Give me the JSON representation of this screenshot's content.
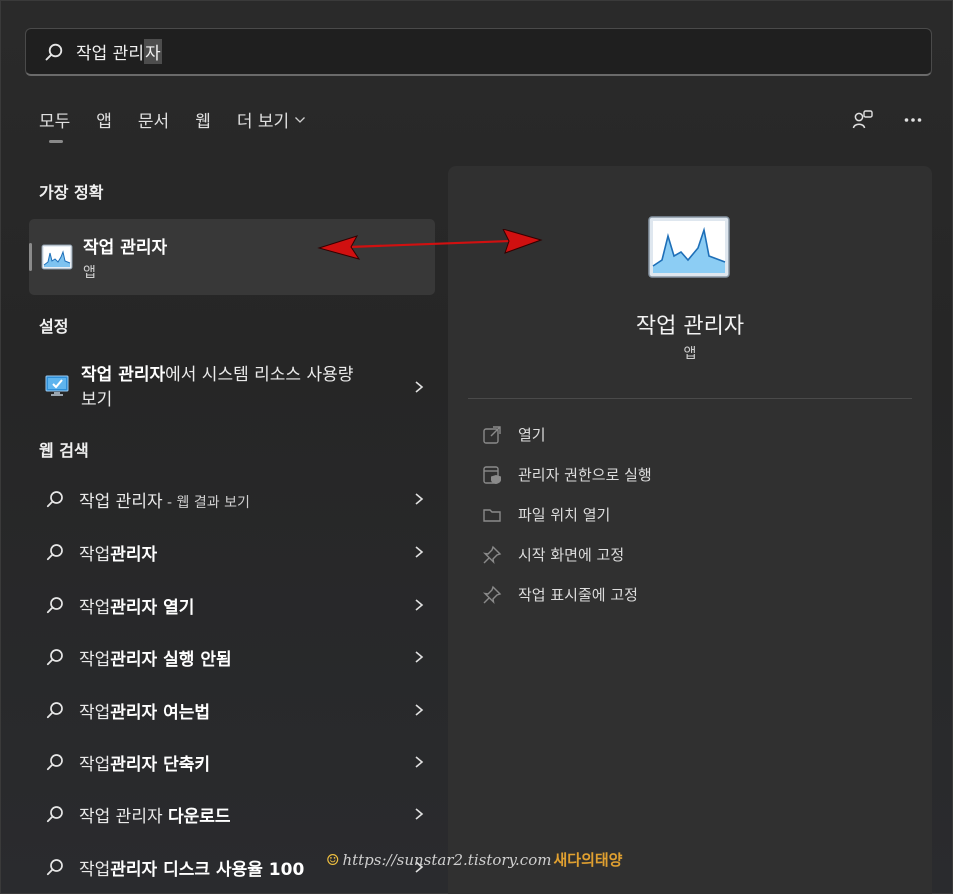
{
  "search": {
    "query_prefix": "작업 관리",
    "query_caret": "자"
  },
  "tabs": [
    {
      "label": "모두"
    },
    {
      "label": "앱"
    },
    {
      "label": "문서"
    },
    {
      "label": "웹"
    },
    {
      "label": "더 보기"
    }
  ],
  "sections": {
    "best_match": "가장 정확",
    "settings": "설정",
    "web_search": "웹 검색"
  },
  "best_match": {
    "title": "작업 관리자",
    "subtitle": "앱"
  },
  "setting_item": {
    "bold": "작업 관리자",
    "rest": "에서 시스템 리소스 사용량 보기"
  },
  "web_items": [
    {
      "bold": "",
      "plain": "작업 관리자",
      "small": " - 웹 결과 보기"
    },
    {
      "plain": "작업",
      "bold": "관리자"
    },
    {
      "plain": "작업",
      "bold": "관리자 열기"
    },
    {
      "plain": "작업",
      "bold": "관리자 실행 안됨"
    },
    {
      "plain": "작업",
      "bold": "관리자 여는법"
    },
    {
      "plain": "작업",
      "bold": "관리자 단축키"
    },
    {
      "plain": "작업 관리자 ",
      "bold": "다운로드"
    },
    {
      "plain": "작업",
      "bold": "관리자 디스크 사용율 100"
    }
  ],
  "right_pane": {
    "title": "작업 관리자",
    "subtitle": "앱",
    "actions": [
      {
        "label": "열기",
        "icon": "open-icon"
      },
      {
        "label": "관리자 권한으로 실행",
        "icon": "admin-icon"
      },
      {
        "label": "파일 위치 열기",
        "icon": "folder-icon"
      },
      {
        "label": "시작 화면에 고정",
        "icon": "pin-icon"
      },
      {
        "label": "작업 표시줄에 고정",
        "icon": "pin-icon"
      }
    ]
  },
  "watermark": {
    "url": "https://sunstar2.tistory.com",
    "name": "새다의태양"
  },
  "colors": {
    "background": "#262626",
    "pane": "#303030",
    "selected": "#383838",
    "arrow": "#d01010"
  }
}
